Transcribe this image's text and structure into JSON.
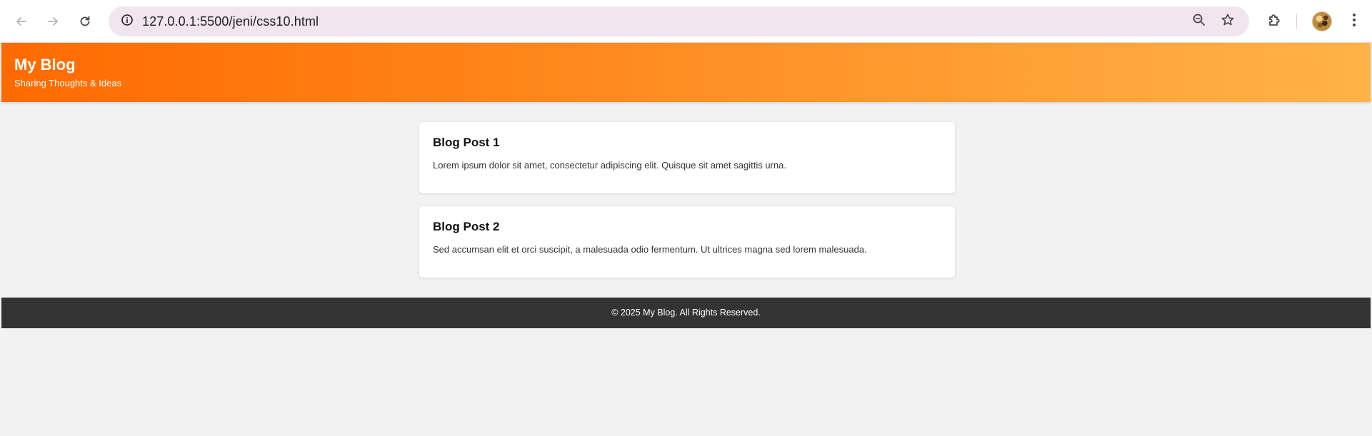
{
  "browser": {
    "url": "127.0.0.1:5500/jeni/css10.html",
    "icons": {
      "back": "arrow-left-icon",
      "forward": "arrow-right-icon",
      "reload": "reload-icon",
      "site_info": "info-icon",
      "zoom": "zoom-out-icon",
      "bookmark": "star-icon",
      "extensions": "puzzle-icon",
      "menu": "kebab-menu-icon"
    }
  },
  "header": {
    "title": "My Blog",
    "tagline": "Sharing Thoughts & Ideas",
    "gradient_start": "#ff6a00",
    "gradient_end": "#ffb347"
  },
  "posts": [
    {
      "title": "Blog Post 1",
      "body": "Lorem ipsum dolor sit amet, consectetur adipiscing elit. Quisque sit amet sagittis urna."
    },
    {
      "title": "Blog Post 2",
      "body": "Sed accumsan elit et orci suscipit, a malesuada odio fermentum. Ut ultrices magna sed lorem malesuada."
    }
  ],
  "footer": {
    "text": "© 2025 My Blog. All Rights Reserved.",
    "background": "#333333"
  }
}
